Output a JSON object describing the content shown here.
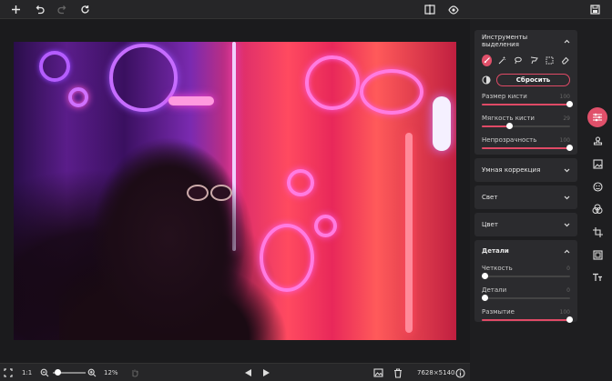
{
  "toolbar": {
    "icons": [
      "add-icon",
      "undo-icon",
      "redo-icon",
      "rotate-icon",
      "compare-icon",
      "preview-icon",
      "save-icon"
    ]
  },
  "bottombar": {
    "fit_icon": "fit-screen-icon",
    "ratio_label": "1:1",
    "zoom_value": "12%",
    "zoom_fraction": 0.12,
    "dimensions": "7628×5140"
  },
  "panel": {
    "selection_tools": {
      "title": "Инструменты выделения",
      "reset_label": "Сбросить",
      "tools": [
        "brush-icon",
        "magic-wand-icon",
        "lasso-icon",
        "polygon-lasso-icon",
        "rect-select-icon",
        "eraser-icon"
      ],
      "sliders": [
        {
          "label": "Размер кисти",
          "value": "100",
          "fraction": 1.0
        },
        {
          "label": "Мягкость кисти",
          "value": "29",
          "fraction": 0.29
        },
        {
          "label": "Непрозрачность",
          "value": "100",
          "fraction": 1.0
        }
      ]
    },
    "smart_correction": {
      "title": "Умная коррекция"
    },
    "light": {
      "title": "Свет"
    },
    "color": {
      "title": "Цвет"
    },
    "details": {
      "title": "Детали",
      "sliders": [
        {
          "label": "Четкость",
          "value": "0",
          "fraction": 0.0
        },
        {
          "label": "Детали",
          "value": "0",
          "fraction": 0.0
        },
        {
          "label": "Размытие",
          "value": "100",
          "fraction": 1.0
        }
      ]
    }
  },
  "rightbar": {
    "icons": [
      "adjustments-icon",
      "stamp-icon",
      "image-icon",
      "face-icon",
      "color-filter-icon",
      "crop-icon",
      "resize-icon",
      "text-icon"
    ]
  },
  "colors": {
    "accent": "#e0506a",
    "panel": "#2b2b2e",
    "background": "#1e1e20"
  }
}
